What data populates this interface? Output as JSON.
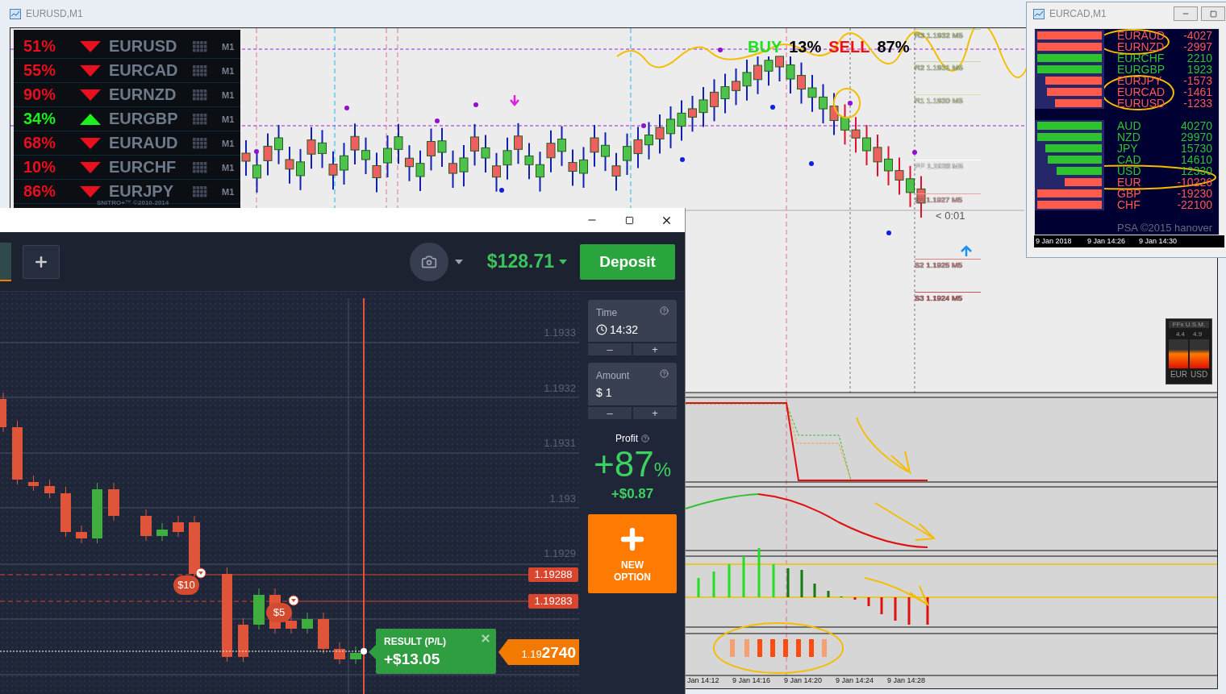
{
  "main_window": {
    "title": "EURUSD,M1",
    "currency_panel": {
      "rows": [
        {
          "percent": "51%",
          "kind": "down",
          "pair": "EURUSD",
          "timeframe": "M1",
          "color": "#e8101c"
        },
        {
          "percent": "55%",
          "kind": "down",
          "pair": "EURCAD",
          "timeframe": "M1",
          "color": "#e8101c"
        },
        {
          "percent": "90%",
          "kind": "down",
          "pair": "EURNZD",
          "timeframe": "M1",
          "color": "#e8101c"
        },
        {
          "percent": "34%",
          "kind": "up",
          "pair": "EURGBP",
          "timeframe": "M1",
          "color": "#1cf01c"
        },
        {
          "percent": "68%",
          "kind": "down",
          "pair": "EURAUD",
          "timeframe": "M1",
          "color": "#e8101c"
        },
        {
          "percent": "10%",
          "kind": "down",
          "pair": "EURCHF",
          "timeframe": "M1",
          "color": "#e8101c"
        },
        {
          "percent": "86%",
          "kind": "down",
          "pair": "EURJPY",
          "timeframe": "M1",
          "color": "#e8101c"
        }
      ],
      "footer": "SNITRO+™ ©2010-2014"
    },
    "signal": {
      "buy": "BUY",
      "buy_share": "13%",
      "sell": "SELL",
      "sell_share": "87%"
    },
    "pivots": [
      {
        "label": "R3 1.1932 M5",
        "color": "#b9d98a"
      },
      {
        "label": "R2 1.1931 M5",
        "color": "#c0dc96"
      },
      {
        "label": "R1 1.1930 M5",
        "color": "#d2e2ae"
      },
      {
        "label": "PP 1.1928 M5",
        "color": "#ffffff"
      },
      {
        "label": "S1 1.1927 M5",
        "color": "#e6a4a4"
      },
      {
        "label": "S2 1.1925 M5",
        "color": "#d88080"
      },
      {
        "label": "S3 1.1924 M5",
        "color": "#cc5050"
      }
    ],
    "countdown": "< 0:01",
    "strength_meter": {
      "title": "FFx U.S.M.",
      "values": [
        "4.4",
        "4.9"
      ],
      "currencies": [
        "EUR",
        "USD"
      ]
    },
    "time_axis": [
      "Jan 14:12",
      "9 Jan 14:16",
      "9 Jan 14:20",
      "9 Jan 14:24",
      "9 Jan 14:28"
    ]
  },
  "strength_window": {
    "title": "EURCAD,M1",
    "pairs": [
      {
        "name": "EURAUD",
        "value": "-4027",
        "level": 1,
        "color": "#ff5a4a"
      },
      {
        "name": "EURNZD",
        "value": "-2997",
        "level": 1,
        "color": "#ff5a4a"
      },
      {
        "name": "EURCHF",
        "value": "2210",
        "level": 1,
        "color": "#2ec42e"
      },
      {
        "name": "EURGBP",
        "value": "1923",
        "level": 1,
        "color": "#2ec42e"
      },
      {
        "name": "EURJPY",
        "value": "-1573",
        "level": 0.88,
        "color": "#ff5a4a"
      },
      {
        "name": "EURCAD",
        "value": "-1461",
        "level": 0.85,
        "color": "#ff5a4a"
      },
      {
        "name": "EURUSD",
        "value": "-1233",
        "level": 0.72,
        "color": "#ff5a4a"
      }
    ],
    "currencies": [
      {
        "name": "AUD",
        "value": "40270",
        "level": 1,
        "color": "#2ec42e"
      },
      {
        "name": "NZD",
        "value": "29970",
        "level": 1,
        "color": "#2ec42e"
      },
      {
        "name": "JPY",
        "value": "15730",
        "level": 0.88,
        "color": "#2ec42e"
      },
      {
        "name": "CAD",
        "value": "14610",
        "level": 0.84,
        "color": "#2ec42e"
      },
      {
        "name": "USD",
        "value": "12330",
        "level": 0.7,
        "color": "#2ec42e"
      },
      {
        "name": "EUR",
        "value": "-10226",
        "level": 0.58,
        "color": "#ff5a4a"
      },
      {
        "name": "GBP",
        "value": "-19230",
        "level": 1,
        "color": "#ff5a4a"
      },
      {
        "name": "CHF",
        "value": "-22100",
        "level": 1,
        "color": "#ff5a4a"
      }
    ],
    "footer": "PSA ©2015 hanover",
    "time_axis": [
      "9 Jan 2018",
      "9 Jan 14:26",
      "9 Jan 14:30"
    ]
  },
  "trade_window": {
    "account_balance": "$128.71",
    "deposit_button": "Deposit",
    "time_field": {
      "label": "Time",
      "value": "14:32",
      "stepper": [
        "–",
        "+"
      ]
    },
    "amount_field": {
      "label": "Amount",
      "value": "$ 1",
      "stepper": [
        "–",
        "+"
      ]
    },
    "profit": {
      "label": "Profit",
      "percent": "+87",
      "percent_sign": "%",
      "payout": "+$0.87"
    },
    "new_option_button": "NEW OPTION",
    "chart": {
      "price_axis": [
        "1.1933",
        "1.1932",
        "1.1931",
        "1.193",
        "1.1929"
      ],
      "price_tags": [
        "1.19288",
        "1.19283"
      ],
      "trade_markers": [
        "$10",
        "$5"
      ],
      "result": {
        "label": "RESULT (P/L)",
        "value": "+$13.05"
      },
      "current_price": {
        "prefix": "1.19",
        "digits": "2740"
      }
    }
  }
}
